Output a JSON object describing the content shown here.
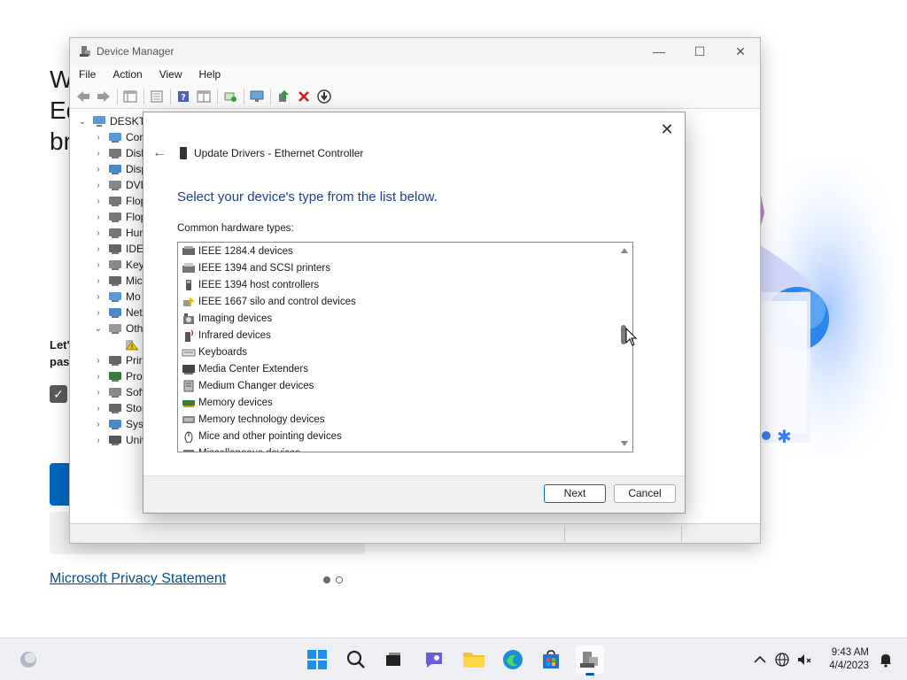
{
  "background": {
    "heading_lines": [
      "We",
      "Ed",
      "br"
    ],
    "para_lines": [
      "Let'",
      "pas"
    ],
    "privacy_link": "Microsoft Privacy Statement"
  },
  "device_manager": {
    "title": "Device Manager",
    "menu": [
      "File",
      "Action",
      "View",
      "Help"
    ],
    "tree_root": "DESKTO",
    "tree_items": [
      {
        "label": "Cor",
        "expand": "›"
      },
      {
        "label": "Disk",
        "expand": "›"
      },
      {
        "label": "Disp",
        "expand": "›"
      },
      {
        "label": "DVD",
        "expand": "›"
      },
      {
        "label": "Flop",
        "expand": "›"
      },
      {
        "label": "Flop",
        "expand": "›"
      },
      {
        "label": "Hun",
        "expand": "›"
      },
      {
        "label": "IDE",
        "expand": "›"
      },
      {
        "label": "Key",
        "expand": "›"
      },
      {
        "label": "Mic",
        "expand": "›"
      },
      {
        "label": "Mo",
        "expand": "›"
      },
      {
        "label": "Net",
        "expand": "›"
      },
      {
        "label": "Oth",
        "expand": "⌄"
      },
      {
        "label": "",
        "expand": ""
      },
      {
        "label": "Prir",
        "expand": "›"
      },
      {
        "label": "Pro",
        "expand": "›"
      },
      {
        "label": "Soft",
        "expand": "›"
      },
      {
        "label": "Stor",
        "expand": "›"
      },
      {
        "label": "Syst",
        "expand": "›"
      },
      {
        "label": "Univ",
        "expand": "›"
      }
    ]
  },
  "dialog": {
    "header_title": "Update Drivers - Ethernet Controller",
    "heading": "Select your device's type from the list below.",
    "list_label": "Common hardware types:",
    "items": [
      "IEEE 1284.4 devices",
      "IEEE 1394 and SCSI printers",
      "IEEE 1394 host controllers",
      "IEEE 1667 silo and control devices",
      "Imaging devices",
      "Infrared devices",
      "Keyboards",
      "Media Center Extenders",
      "Medium Changer devices",
      "Memory devices",
      "Memory technology devices",
      "Mice and other pointing devices",
      "Miscellaneous devices"
    ],
    "next_label": "Next",
    "cancel_label": "Cancel"
  },
  "taskbar": {
    "time": "9:43 AM",
    "date": "4/4/2023"
  }
}
